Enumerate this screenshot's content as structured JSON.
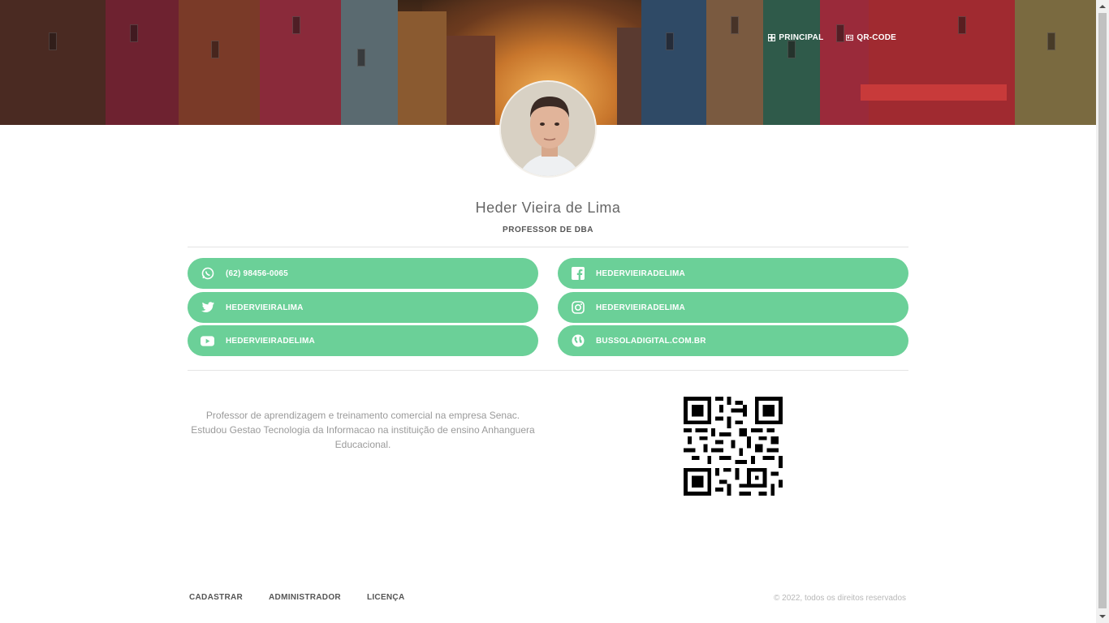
{
  "nav": {
    "principal": "PRINCIPAL",
    "qrcode": "QR-CODE"
  },
  "profile": {
    "name": "Heder Vieira de Lima",
    "role": "PROFESSOR DE DBA"
  },
  "links": {
    "whatsapp": "(62) 98456-0065",
    "facebook": "HEDERVIEIRADELIMA",
    "twitter": "HEDERVIEIRALIMA",
    "instagram": "HEDERVIEIRADELIMA",
    "youtube": "HEDERVIEIRADELIMA",
    "website": "BUSSOLADIGITAL.COM.BR"
  },
  "bio": "Professor de aprendizagem e treinamento comercial na empresa Senac. Estudou Gestao Tecnologia da Informacao na instituição de ensino Anhanguera Educacional.",
  "footer": {
    "cadastrar": "CADASTRAR",
    "administrador": "ADMINISTRADOR",
    "licenca": "LICENÇA",
    "copyright": "© 2022, todos os direitos reservados"
  },
  "colors": {
    "accent": "#6bd098",
    "text_muted": "#9a9a9a"
  }
}
